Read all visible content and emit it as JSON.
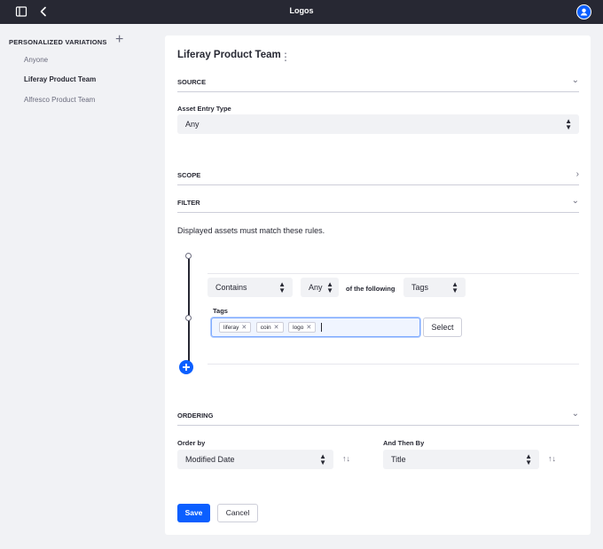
{
  "topbar": {
    "title": "Logos",
    "sidebar_toggle_icon": "sidebar-toggle-icon",
    "back_icon": "chevron-left-icon",
    "user_icon": "user-avatar-icon"
  },
  "sidebar": {
    "heading": "PERSONALIZED VARIATIONS",
    "add_icon": "plus-icon",
    "items": [
      {
        "label": "Anyone",
        "active": false
      },
      {
        "label": "Liferay Product Team",
        "active": true
      },
      {
        "label": "Alfresco Product Team",
        "active": false
      }
    ]
  },
  "panel": {
    "title": "Liferay Product Team",
    "source": {
      "heading": "SOURCE",
      "asset_entry_type_label": "Asset Entry Type",
      "asset_entry_type_value": "Any"
    },
    "scope": {
      "heading": "SCOPE"
    },
    "filter": {
      "heading": "FILTER",
      "description": "Displayed assets must match these rules.",
      "rule": {
        "operator": "Contains",
        "quantifier": "Any",
        "of_the_following": "of the following",
        "field": "Tags",
        "tags_label": "Tags",
        "tags": [
          "liferay",
          "coin",
          "logo"
        ],
        "select_label": "Select"
      }
    },
    "ordering": {
      "heading": "ORDERING",
      "order_by_label": "Order by",
      "order_by_value": "Modified Date",
      "then_by_label": "And Then By",
      "then_by_value": "Title"
    },
    "actions": {
      "save": "Save",
      "cancel": "Cancel"
    }
  },
  "colors": {
    "primary": "#0b5fff",
    "topbar": "#272833",
    "background": "#f1f2f5"
  }
}
